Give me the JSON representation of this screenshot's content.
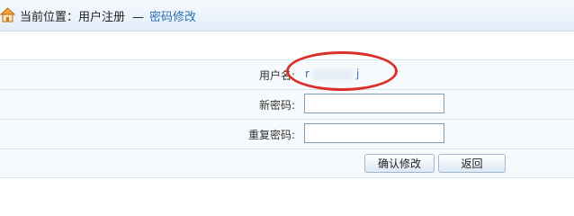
{
  "breadcrumb": {
    "prefix": "当前位置：",
    "section": "用户注册",
    "separator": "—",
    "current": "密码修改"
  },
  "form": {
    "username_label": "用户名:",
    "username_value_start": "r",
    "username_value_end": "j",
    "new_password_label": "新密码:",
    "new_password_value": "",
    "repeat_password_label": "重复密码:",
    "repeat_password_value": ""
  },
  "buttons": {
    "confirm_label": "确认修改",
    "back_label": "返回"
  },
  "colors": {
    "accent": "#2a6fb5",
    "annotation": "#d9302a"
  },
  "icons": {
    "home": "home-icon"
  }
}
